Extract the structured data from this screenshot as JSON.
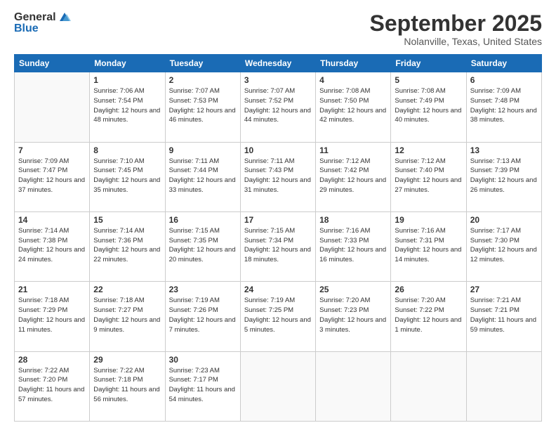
{
  "logo": {
    "general": "General",
    "blue": "Blue"
  },
  "header": {
    "month": "September 2025",
    "location": "Nolanville, Texas, United States"
  },
  "days": [
    "Sunday",
    "Monday",
    "Tuesday",
    "Wednesday",
    "Thursday",
    "Friday",
    "Saturday"
  ],
  "weeks": [
    [
      {
        "num": "",
        "sunrise": "",
        "sunset": "",
        "daylight": ""
      },
      {
        "num": "1",
        "sunrise": "Sunrise: 7:06 AM",
        "sunset": "Sunset: 7:54 PM",
        "daylight": "Daylight: 12 hours and 48 minutes."
      },
      {
        "num": "2",
        "sunrise": "Sunrise: 7:07 AM",
        "sunset": "Sunset: 7:53 PM",
        "daylight": "Daylight: 12 hours and 46 minutes."
      },
      {
        "num": "3",
        "sunrise": "Sunrise: 7:07 AM",
        "sunset": "Sunset: 7:52 PM",
        "daylight": "Daylight: 12 hours and 44 minutes."
      },
      {
        "num": "4",
        "sunrise": "Sunrise: 7:08 AM",
        "sunset": "Sunset: 7:50 PM",
        "daylight": "Daylight: 12 hours and 42 minutes."
      },
      {
        "num": "5",
        "sunrise": "Sunrise: 7:08 AM",
        "sunset": "Sunset: 7:49 PM",
        "daylight": "Daylight: 12 hours and 40 minutes."
      },
      {
        "num": "6",
        "sunrise": "Sunrise: 7:09 AM",
        "sunset": "Sunset: 7:48 PM",
        "daylight": "Daylight: 12 hours and 38 minutes."
      }
    ],
    [
      {
        "num": "7",
        "sunrise": "Sunrise: 7:09 AM",
        "sunset": "Sunset: 7:47 PM",
        "daylight": "Daylight: 12 hours and 37 minutes."
      },
      {
        "num": "8",
        "sunrise": "Sunrise: 7:10 AM",
        "sunset": "Sunset: 7:45 PM",
        "daylight": "Daylight: 12 hours and 35 minutes."
      },
      {
        "num": "9",
        "sunrise": "Sunrise: 7:11 AM",
        "sunset": "Sunset: 7:44 PM",
        "daylight": "Daylight: 12 hours and 33 minutes."
      },
      {
        "num": "10",
        "sunrise": "Sunrise: 7:11 AM",
        "sunset": "Sunset: 7:43 PM",
        "daylight": "Daylight: 12 hours and 31 minutes."
      },
      {
        "num": "11",
        "sunrise": "Sunrise: 7:12 AM",
        "sunset": "Sunset: 7:42 PM",
        "daylight": "Daylight: 12 hours and 29 minutes."
      },
      {
        "num": "12",
        "sunrise": "Sunrise: 7:12 AM",
        "sunset": "Sunset: 7:40 PM",
        "daylight": "Daylight: 12 hours and 27 minutes."
      },
      {
        "num": "13",
        "sunrise": "Sunrise: 7:13 AM",
        "sunset": "Sunset: 7:39 PM",
        "daylight": "Daylight: 12 hours and 26 minutes."
      }
    ],
    [
      {
        "num": "14",
        "sunrise": "Sunrise: 7:14 AM",
        "sunset": "Sunset: 7:38 PM",
        "daylight": "Daylight: 12 hours and 24 minutes."
      },
      {
        "num": "15",
        "sunrise": "Sunrise: 7:14 AM",
        "sunset": "Sunset: 7:36 PM",
        "daylight": "Daylight: 12 hours and 22 minutes."
      },
      {
        "num": "16",
        "sunrise": "Sunrise: 7:15 AM",
        "sunset": "Sunset: 7:35 PM",
        "daylight": "Daylight: 12 hours and 20 minutes."
      },
      {
        "num": "17",
        "sunrise": "Sunrise: 7:15 AM",
        "sunset": "Sunset: 7:34 PM",
        "daylight": "Daylight: 12 hours and 18 minutes."
      },
      {
        "num": "18",
        "sunrise": "Sunrise: 7:16 AM",
        "sunset": "Sunset: 7:33 PM",
        "daylight": "Daylight: 12 hours and 16 minutes."
      },
      {
        "num": "19",
        "sunrise": "Sunrise: 7:16 AM",
        "sunset": "Sunset: 7:31 PM",
        "daylight": "Daylight: 12 hours and 14 minutes."
      },
      {
        "num": "20",
        "sunrise": "Sunrise: 7:17 AM",
        "sunset": "Sunset: 7:30 PM",
        "daylight": "Daylight: 12 hours and 12 minutes."
      }
    ],
    [
      {
        "num": "21",
        "sunrise": "Sunrise: 7:18 AM",
        "sunset": "Sunset: 7:29 PM",
        "daylight": "Daylight: 12 hours and 11 minutes."
      },
      {
        "num": "22",
        "sunrise": "Sunrise: 7:18 AM",
        "sunset": "Sunset: 7:27 PM",
        "daylight": "Daylight: 12 hours and 9 minutes."
      },
      {
        "num": "23",
        "sunrise": "Sunrise: 7:19 AM",
        "sunset": "Sunset: 7:26 PM",
        "daylight": "Daylight: 12 hours and 7 minutes."
      },
      {
        "num": "24",
        "sunrise": "Sunrise: 7:19 AM",
        "sunset": "Sunset: 7:25 PM",
        "daylight": "Daylight: 12 hours and 5 minutes."
      },
      {
        "num": "25",
        "sunrise": "Sunrise: 7:20 AM",
        "sunset": "Sunset: 7:23 PM",
        "daylight": "Daylight: 12 hours and 3 minutes."
      },
      {
        "num": "26",
        "sunrise": "Sunrise: 7:20 AM",
        "sunset": "Sunset: 7:22 PM",
        "daylight": "Daylight: 12 hours and 1 minute."
      },
      {
        "num": "27",
        "sunrise": "Sunrise: 7:21 AM",
        "sunset": "Sunset: 7:21 PM",
        "daylight": "Daylight: 11 hours and 59 minutes."
      }
    ],
    [
      {
        "num": "28",
        "sunrise": "Sunrise: 7:22 AM",
        "sunset": "Sunset: 7:20 PM",
        "daylight": "Daylight: 11 hours and 57 minutes."
      },
      {
        "num": "29",
        "sunrise": "Sunrise: 7:22 AM",
        "sunset": "Sunset: 7:18 PM",
        "daylight": "Daylight: 11 hours and 56 minutes."
      },
      {
        "num": "30",
        "sunrise": "Sunrise: 7:23 AM",
        "sunset": "Sunset: 7:17 PM",
        "daylight": "Daylight: 11 hours and 54 minutes."
      },
      {
        "num": "",
        "sunrise": "",
        "sunset": "",
        "daylight": ""
      },
      {
        "num": "",
        "sunrise": "",
        "sunset": "",
        "daylight": ""
      },
      {
        "num": "",
        "sunrise": "",
        "sunset": "",
        "daylight": ""
      },
      {
        "num": "",
        "sunrise": "",
        "sunset": "",
        "daylight": ""
      }
    ]
  ]
}
